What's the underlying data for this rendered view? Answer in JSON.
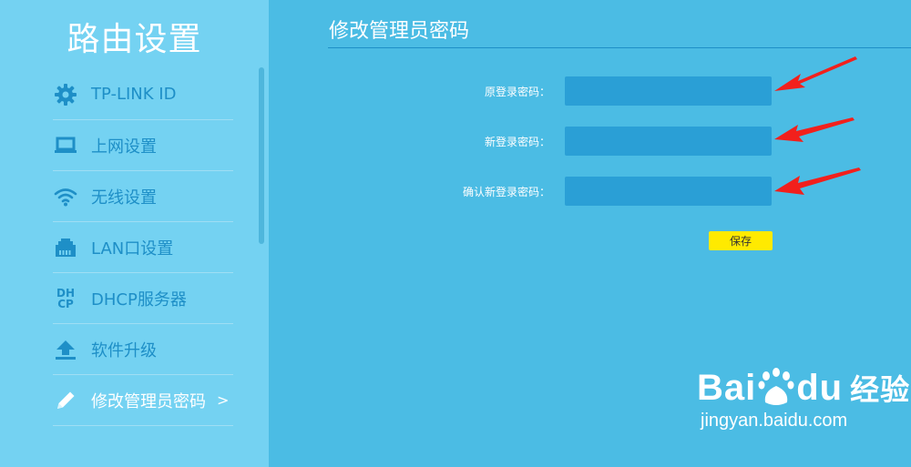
{
  "sidebar": {
    "title": "路由设置",
    "items": [
      {
        "label": "TP-LINK ID",
        "icon": "gear-icon"
      },
      {
        "label": "上网设置",
        "icon": "laptop-icon"
      },
      {
        "label": "无线设置",
        "icon": "wifi-icon"
      },
      {
        "label": "LAN口设置",
        "icon": "lan-port-icon"
      },
      {
        "label": "DHCP服务器",
        "icon": "dhcp-icon",
        "icon_text_top": "DH",
        "icon_text_bottom": "CP"
      },
      {
        "label": "软件升级",
        "icon": "upload-icon"
      },
      {
        "label": "修改管理员密码",
        "icon": "pencil-icon",
        "active": true,
        "arrow": ">"
      }
    ]
  },
  "main": {
    "title": "修改管理员密码",
    "fields": [
      {
        "label": "原登录密码：",
        "value": ""
      },
      {
        "label": "新登录密码：",
        "value": ""
      },
      {
        "label": "确认新登录密码：",
        "value": ""
      }
    ],
    "save_label": "保存"
  },
  "watermark": {
    "brand_left": "Bai",
    "brand_mid": "du",
    "brand_right": "经验",
    "url": "jingyan.baidu.com"
  },
  "colors": {
    "sidebar_bg": "#74d2f2",
    "main_bg": "#4bbce4",
    "input_bg": "#2a9fd6",
    "accent_text": "#1e8fc7",
    "save_button": "#ffea00",
    "annotation_arrow": "#f2201c"
  }
}
